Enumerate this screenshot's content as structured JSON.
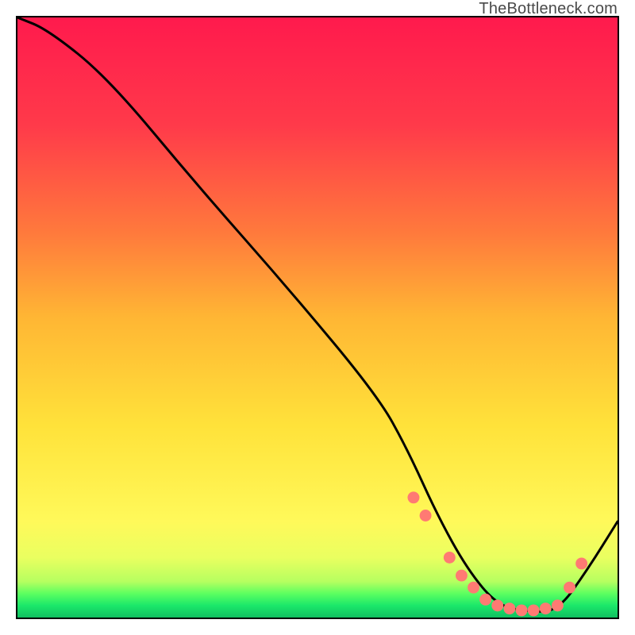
{
  "watermark": "TheBottleneck.com",
  "chart_data": {
    "type": "line",
    "title": "",
    "xlabel": "",
    "ylabel": "",
    "xlim": [
      0,
      100
    ],
    "ylim": [
      0,
      100
    ],
    "grid": false,
    "legend": false,
    "background_gradient": {
      "direction": "vertical",
      "stops": [
        {
          "pos": 0,
          "color": "#ff1a4d"
        },
        {
          "pos": 0.5,
          "color": "#ffb634"
        },
        {
          "pos": 0.84,
          "color": "#fff95a"
        },
        {
          "pos": 0.95,
          "color": "#5cff60"
        },
        {
          "pos": 1.0,
          "color": "#0fbf60"
        }
      ]
    },
    "series": [
      {
        "name": "bottleneck-curve",
        "x": [
          0,
          5,
          15,
          30,
          45,
          60,
          65,
          70,
          75,
          80,
          85,
          90,
          95,
          100
        ],
        "y": [
          100,
          98,
          90,
          72,
          55,
          37,
          28,
          17,
          8,
          2,
          1,
          1,
          8,
          16
        ]
      }
    ],
    "markers": {
      "name": "highlighted-points",
      "color": "#ff7a73",
      "x": [
        66,
        68,
        72,
        74,
        76,
        78,
        80,
        82,
        84,
        86,
        88,
        90,
        92,
        94
      ],
      "y": [
        20,
        17,
        10,
        7,
        5,
        3,
        2,
        1.5,
        1.2,
        1.2,
        1.5,
        2,
        5,
        9
      ]
    }
  }
}
